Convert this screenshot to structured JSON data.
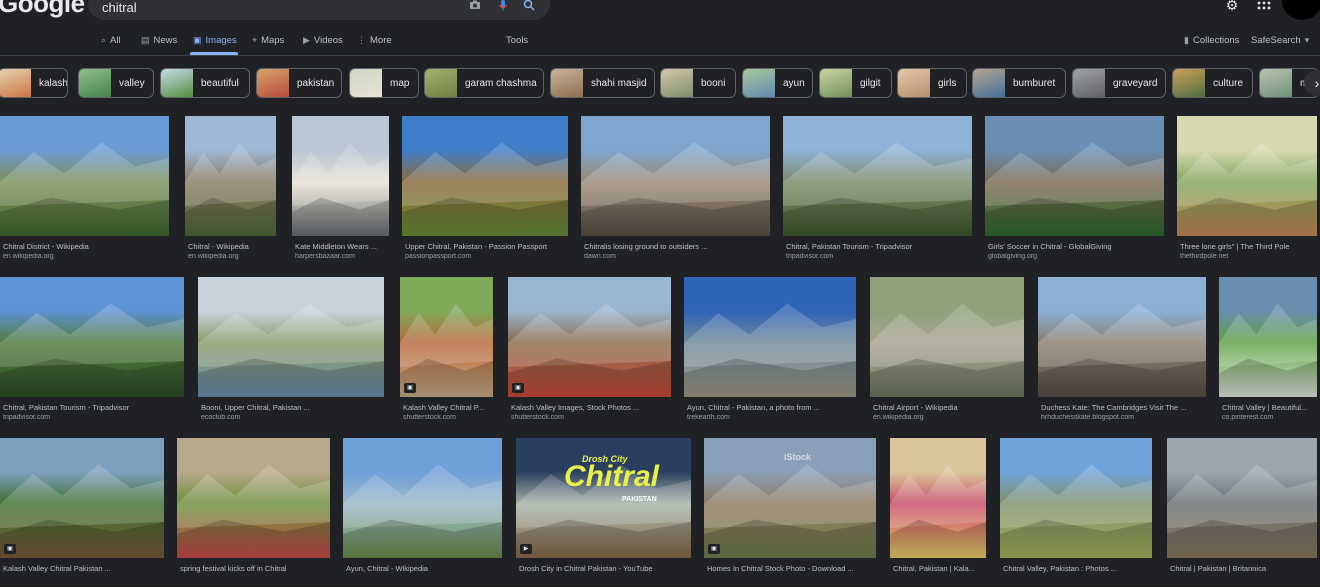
{
  "header": {
    "logo": "Google",
    "query": "chitral",
    "icons": [
      "camera-icon",
      "mic-icon",
      "search-icon",
      "gear-icon",
      "apps-icon"
    ]
  },
  "nav": {
    "all": "All",
    "news": "News",
    "images": "Images",
    "maps": "Maps",
    "videos": "Videos",
    "more": "More",
    "tools": "Tools",
    "collections": "Collections",
    "safesearch": "SafeSearch"
  },
  "chips": [
    "kalash",
    "valley",
    "beautiful",
    "pakistan",
    "map",
    "garam chashma",
    "shahi masjid",
    "booni",
    "ayun",
    "gilgit",
    "girls",
    "bumburet",
    "graveyard",
    "culture",
    "m"
  ],
  "rows": [
    [
      {
        "title": "Chitral District - Wikipedia",
        "source": "en.wikipedia.org"
      },
      {
        "title": "Chitral - Wikipedia",
        "source": "en.wikipedia.org"
      },
      {
        "title": "Kate Middleton Wears ...",
        "source": "harpersbazaar.com"
      },
      {
        "title": "Upper Chitral, Pakistan - Passion Passport",
        "source": "passionpassport.com"
      },
      {
        "title": "Chitralis losing ground to outsiders ...",
        "source": "dawn.com"
      },
      {
        "title": "Chitral, Pakistan Tourism - Tripadvisor",
        "source": "tripadvisor.com"
      },
      {
        "title": "Girls' Soccer in Chitral - GlobalGiving",
        "source": "globalgiving.org"
      },
      {
        "title": "Three lone girls\" | The Third Pole",
        "source": "thethirdpole.net"
      }
    ],
    [
      {
        "title": "Chitral, Pakistan Tourism - Tripadvisor",
        "source": "tripadvisor.com"
      },
      {
        "title": "Booni, Upper Chitral, Pakistan ...",
        "source": "ecoclub.com"
      },
      {
        "title": "Kalash Valley Chitral P...",
        "source": "shutterstock.com"
      },
      {
        "title": "Kalash Valley Images, Stock Photos ...",
        "source": "shutterstock.com"
      },
      {
        "title": "Ayun, Chitral - Pakistan, a photo from ...",
        "source": "trekearth.com"
      },
      {
        "title": "Chitral Airport - Wikipedia",
        "source": "en.wikipedia.org"
      },
      {
        "title": "Duchess Kate: The Cambridges Visit The ...",
        "source": "hrhduchesskate.blogspot.com"
      },
      {
        "title": "Chitral Valley | Beautiful...",
        "source": "co.pinterest.com"
      }
    ],
    [
      {
        "title": "Kalash Valley Chitral Pakistan ...",
        "source": ""
      },
      {
        "title": "spring festival kicks off in Chitral",
        "source": ""
      },
      {
        "title": "Ayun, Chitral - Wikipedia",
        "source": ""
      },
      {
        "title": "Drosh City in Chitral Pakistan - YouTube",
        "source": "",
        "overlay": "Chitral",
        "overlay_top": "Drosh City",
        "overlay_sub": "PAKISTAN"
      },
      {
        "title": "Homes In Chitral Stock Photo - Download ...",
        "source": "",
        "overlay": "iStock"
      },
      {
        "title": "Chitral, Pakistan | Kala...",
        "source": ""
      },
      {
        "title": "Chitral Valley, Pakistan : Photos ...",
        "source": ""
      },
      {
        "title": "Chitral | Pakistan | Britannica",
        "source": ""
      }
    ]
  ],
  "colors": {
    "background": "#202124",
    "accent": "#8ab4f8",
    "chip_border": "#5f6368"
  }
}
